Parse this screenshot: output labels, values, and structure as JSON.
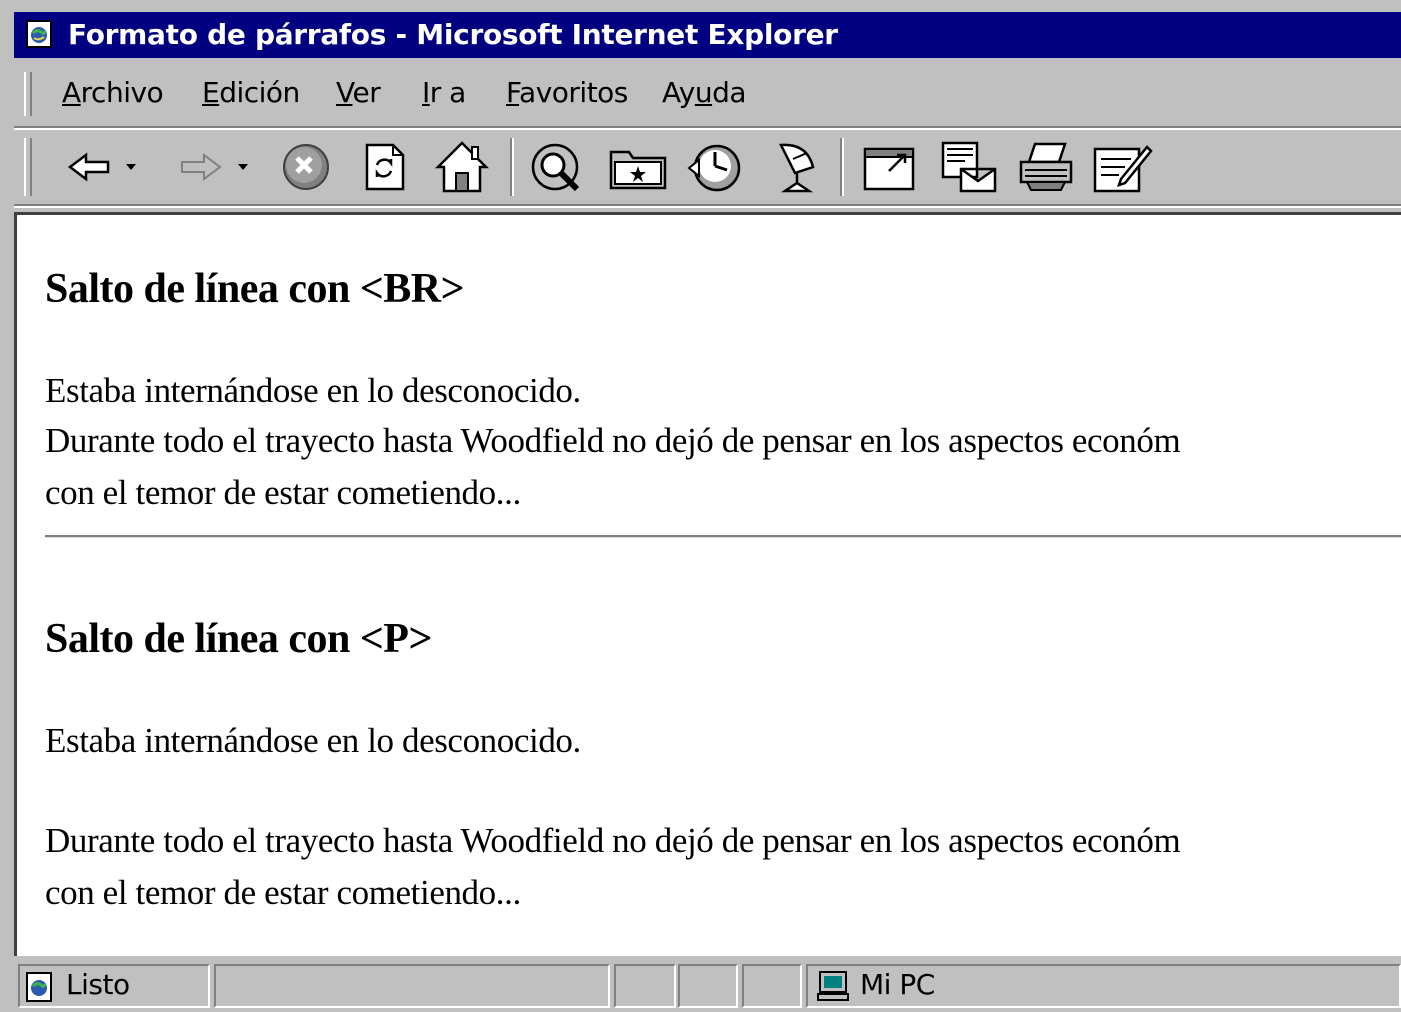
{
  "window": {
    "title": "Formato de párrafos - Microsoft Internet Explorer",
    "icon": "ie-page-icon"
  },
  "menu": {
    "items": [
      {
        "label": "Archivo",
        "accel": "A"
      },
      {
        "label": "Edición",
        "accel": "E"
      },
      {
        "label": "Ver",
        "accel": "V"
      },
      {
        "label": "Ir a",
        "accel": "I"
      },
      {
        "label": "Favoritos",
        "accel": "F"
      },
      {
        "label": "Ayuda",
        "accel": "u"
      }
    ]
  },
  "toolbar": {
    "buttons": [
      "back-icon",
      "forward-icon",
      "stop-icon",
      "refresh-icon",
      "home-icon",
      "search-icon",
      "favorites-icon",
      "history-icon",
      "channels-icon",
      "fullscreen-icon",
      "mail-icon",
      "print-icon",
      "edit-icon"
    ]
  },
  "content": {
    "section1": {
      "heading": "Salto de línea con <BR>",
      "line1": "Estaba internándose en lo desconocido.",
      "line2": "Durante todo el trayecto hasta Woodfield no dejó de pensar en los aspectos económ",
      "line3": "con el temor de estar cometiendo..."
    },
    "section2": {
      "heading": "Salto de línea con <P>",
      "para1": "Estaba internándose en lo desconocido.",
      "para2_line1": "Durante todo el trayecto hasta Woodfield no dejó de pensar en los aspectos económ",
      "para2_line2": "con el temor de estar cometiendo..."
    }
  },
  "status": {
    "text": "Listo",
    "zone": "Mi PC"
  },
  "colors": {
    "titlebar": "#000080",
    "chrome": "#c0c0c0",
    "page": "#ffffff"
  }
}
